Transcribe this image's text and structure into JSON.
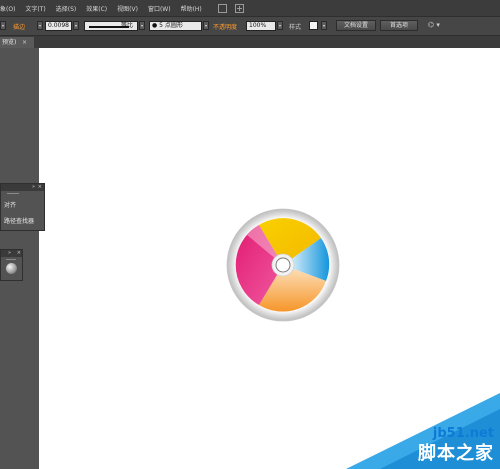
{
  "menubar": {
    "items": [
      "象(O)",
      "文字(T)",
      "选择(S)",
      "效果(C)",
      "视图(V)",
      "窗口(W)",
      "帮助(H)"
    ]
  },
  "controlbar": {
    "stroke_label": "描边",
    "stroke_weight": "0.0098",
    "stroke_profile": "等比",
    "brush": "5 点圆形",
    "opacity_label": "不透明度",
    "opacity_value": "100%",
    "style_label": "样式",
    "doc_setup": "文档设置",
    "preferences": "首选项"
  },
  "tab": {
    "label": "预览)",
    "close": "×"
  },
  "panel": {
    "dbl": "»",
    "close": "×",
    "items": [
      "对齐",
      "路径查找器"
    ]
  },
  "panel2": {
    "dbl": "»",
    "close": "×"
  },
  "watermark": {
    "site": "jb51.net",
    "brand": "脚本之家"
  },
  "colors": {
    "app_bg": "#535353",
    "accent_orange": "#ff9b2e",
    "disc_yellow": "#f5c400",
    "disc_magenta": "#e0187a",
    "disc_blue": "#1a9fe0",
    "disc_orange": "#f7a030"
  }
}
